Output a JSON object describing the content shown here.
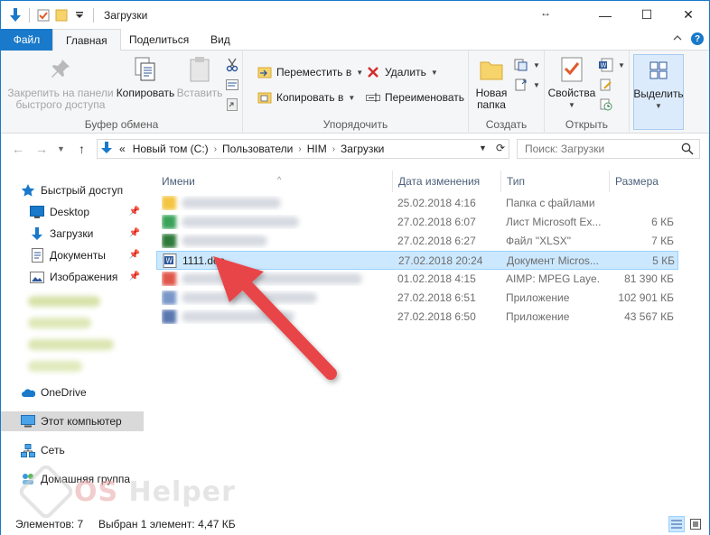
{
  "window": {
    "title": "Загрузки",
    "resize_glyph": "↔",
    "minimize": "—",
    "maximize": "☐",
    "close": "✕"
  },
  "tabs": {
    "file": "Файл",
    "home": "Главная",
    "share": "Поделиться",
    "view": "Вид"
  },
  "ribbon": {
    "clipboard": {
      "label": "Буфер обмена",
      "pin_line1": "Закрепить на панели",
      "pin_line2": "быстрого доступа",
      "copy": "Копировать",
      "paste": "Вставить"
    },
    "organize": {
      "label": "Упорядочить",
      "move_to": "Переместить в",
      "copy_to": "Копировать в",
      "delete": "Удалить",
      "rename": "Переименовать"
    },
    "new": {
      "label": "Создать",
      "new_folder_line1": "Новая",
      "new_folder_line2": "папка"
    },
    "open": {
      "label": "Открыть",
      "properties": "Свойства"
    },
    "select": {
      "select_label": "Выделить"
    }
  },
  "address": {
    "overflow": "«",
    "crumbs": [
      "Новый том (C:)",
      "Пользователи",
      "HIM",
      "Загрузки"
    ],
    "search_placeholder": "Поиск: Загрузки"
  },
  "sidebar": {
    "quick_access": "Быстрый доступ",
    "items": [
      {
        "label": "Desktop",
        "pinned": true
      },
      {
        "label": "Загрузки",
        "pinned": true
      },
      {
        "label": "Документы",
        "pinned": true
      },
      {
        "label": "Изображения",
        "pinned": true
      }
    ],
    "onedrive": "OneDrive",
    "this_pc": "Этот компьютер",
    "network": "Сеть",
    "homegroup": "Домашняя группа"
  },
  "columns": {
    "name": "Имени",
    "date": "Дата изменения",
    "type": "Тип",
    "size": "Размера"
  },
  "files": [
    {
      "name": "",
      "date": "25.02.2018 4:16",
      "type": "Папка с файлами",
      "size": "",
      "blurred": true,
      "icon_color": "#f4c542"
    },
    {
      "name": "",
      "date": "27.02.2018 6:07",
      "type": "Лист Microsoft Ex...",
      "size": "6 КБ",
      "blurred": true,
      "icon_color": "#3aa35a"
    },
    {
      "name": "",
      "date": "27.02.2018 6:27",
      "type": "Файл \"XLSX\"",
      "size": "7 КБ",
      "blurred": true,
      "icon_color": "#2f7a3a"
    },
    {
      "name": "1111.doc",
      "date": "27.02.2018 20:24",
      "type": "Документ Micros...",
      "size": "5 КБ",
      "blurred": false,
      "icon_color": "#2b579a"
    },
    {
      "name": "",
      "date": "01.02.2018 4:15",
      "type": "AIMP: MPEG Laye...",
      "size": "81 390 КБ",
      "blurred": true,
      "icon_color": "#e0564a"
    },
    {
      "name": "",
      "date": "27.02.2018 6:51",
      "type": "Приложение",
      "size": "102 901 КБ",
      "blurred": true,
      "icon_color": "#7a96c8"
    },
    {
      "name": "",
      "date": "27.02.2018 6:50",
      "type": "Приложение",
      "size": "43 567 КБ",
      "blurred": true,
      "icon_color": "#5a78b0"
    }
  ],
  "status": {
    "count": "Элементов: 7",
    "selection": "Выбран 1 элемент: 4,47 КБ"
  },
  "watermark": {
    "text_os": "OS",
    "text_rest": " Helper"
  },
  "colors": {
    "accent": "#1979ca",
    "selection": "#cce8ff",
    "arrow": "#e8454a"
  }
}
